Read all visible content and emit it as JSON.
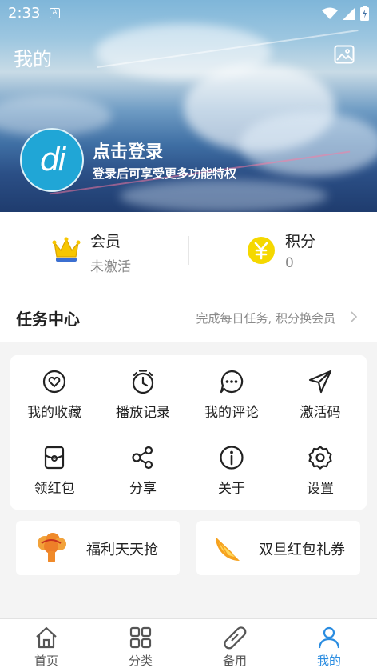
{
  "status_bar": {
    "time": "2:33",
    "notification_letter": "A"
  },
  "header": {
    "title": "我的"
  },
  "profile": {
    "avatar_text": "di",
    "login_title": "点击登录",
    "login_subtitle": "登录后可享受更多功能特权"
  },
  "membership": {
    "vip": {
      "title": "会员",
      "value": "未激活",
      "icon": "crown-icon"
    },
    "points": {
      "title": "积分",
      "value": "0",
      "icon": "yen-coin-icon"
    }
  },
  "task_center": {
    "title": "任务中心",
    "hint": "完成每日任务, 积分换会员"
  },
  "grid": [
    {
      "label": "我的收藏",
      "icon": "heart-icon"
    },
    {
      "label": "播放记录",
      "icon": "timer-icon"
    },
    {
      "label": "我的评论",
      "icon": "comment-icon"
    },
    {
      "label": "激活码",
      "icon": "send-icon"
    },
    {
      "label": "领红包",
      "icon": "red-packet-icon"
    },
    {
      "label": "分享",
      "icon": "share-icon"
    },
    {
      "label": "关于",
      "icon": "info-icon"
    },
    {
      "label": "设置",
      "icon": "settings-icon"
    }
  ],
  "promos": [
    {
      "label": "福利天天抢",
      "icon": "broccoli-icon"
    },
    {
      "label": "双旦红包礼券",
      "icon": "orange-slice-icon"
    }
  ],
  "bottom_nav": [
    {
      "label": "首页",
      "icon": "home-icon",
      "active": false
    },
    {
      "label": "分类",
      "icon": "category-icon",
      "active": false
    },
    {
      "label": "备用",
      "icon": "bandage-icon",
      "active": false
    },
    {
      "label": "我的",
      "icon": "user-icon",
      "active": true
    }
  ],
  "colors": {
    "accent": "#2a8ce0",
    "avatar_bg": "#20a6d6",
    "coin": "#f5d800"
  }
}
